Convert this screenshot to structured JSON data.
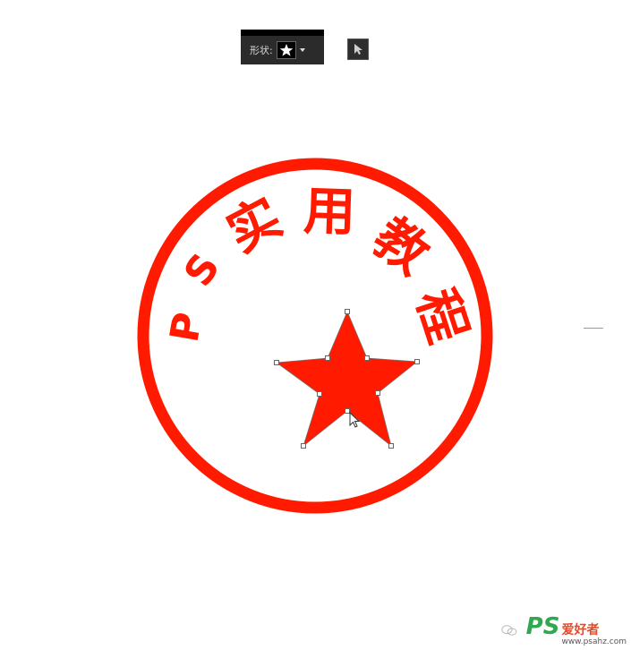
{
  "toolbar": {
    "shape_label": "形状:",
    "shape_icon": "star-icon",
    "select_tool_icon": "arrow-cursor-icon"
  },
  "seal": {
    "arc_text": [
      "P",
      "S",
      "实",
      "用",
      "教",
      "程"
    ],
    "color": "#ff1a00",
    "star_icon": "star-icon"
  },
  "watermark": {
    "icon": "chat-icon",
    "logo": "PS",
    "site_name": "爱好者",
    "url": "www.psahz.com"
  }
}
